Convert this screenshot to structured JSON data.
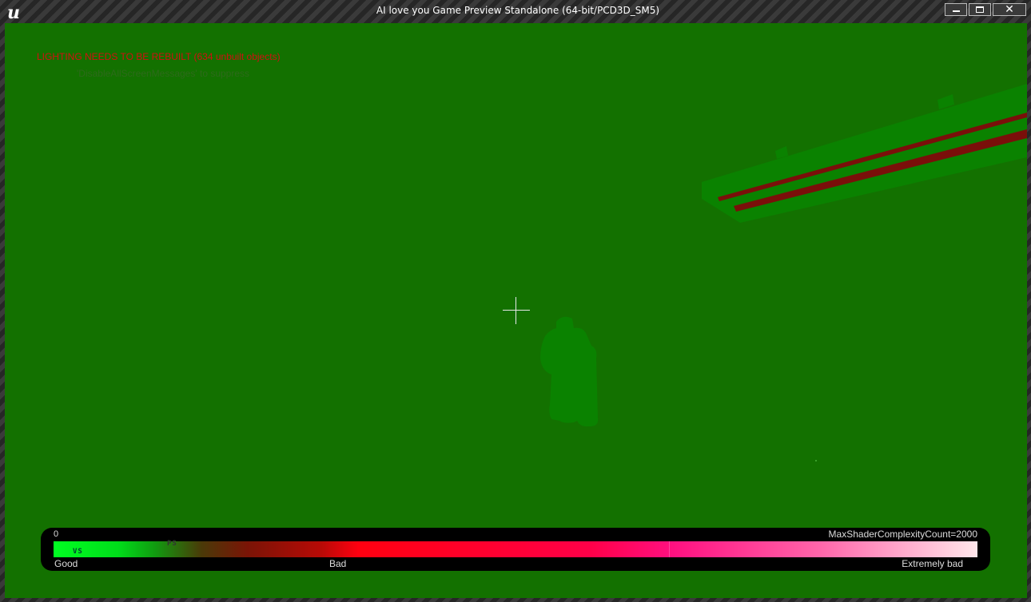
{
  "window": {
    "title": "AI love you Game Preview Standalone (64-bit/PCD3D_SM5)",
    "logo": "u",
    "controls": {
      "minimize_icon": "minimize-icon",
      "maximize_icon": "maximize-icon",
      "close_glyph": "✕"
    }
  },
  "messages": {
    "lighting_warning": "LIGHTING NEEDS TO BE REBUILT (634 unbuilt objects)",
    "suppress_hint": "'DisableAllScreenMessages' to suppress"
  },
  "legend": {
    "min_value": "0",
    "max_count_label": "MaxShaderComplexityCount=2000",
    "ps_marker": "PS",
    "vs_marker": "VS",
    "labels": {
      "good": "Good",
      "bad": "Bad",
      "extremely_bad": "Extremely bad"
    }
  },
  "colors": {
    "viewport_background": "#137100",
    "mesh_green": "#0a8200",
    "stripe_red": "#7a0f0a",
    "warning_red": "#d11010"
  }
}
